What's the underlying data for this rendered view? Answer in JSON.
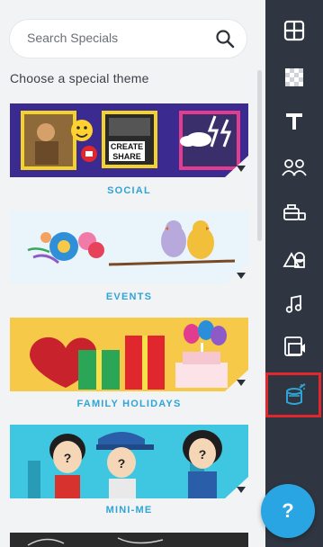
{
  "search": {
    "placeholder": "Search Specials",
    "icon": "search-icon"
  },
  "heading": "Choose a special theme",
  "cards": [
    {
      "label": "SOCIAL",
      "art": {
        "create_line1": "CREATE",
        "create_line2": "SHARE"
      }
    },
    {
      "label": "EVENTS"
    },
    {
      "label": "FAMILY HOLIDAYS"
    },
    {
      "label": "MINI-ME"
    }
  ],
  "sidebar": {
    "items": [
      {
        "name": "layout-icon"
      },
      {
        "name": "background-pattern-icon"
      },
      {
        "name": "text-icon"
      },
      {
        "name": "people-icon"
      },
      {
        "name": "objects-icon"
      },
      {
        "name": "shapes-icon"
      },
      {
        "name": "music-icon"
      },
      {
        "name": "video-icon"
      },
      {
        "name": "specials-icon",
        "selected": true
      }
    ],
    "help_label": "?"
  },
  "colors": {
    "sidebar_bg": "#2f3641",
    "accent": "#2fa4d6",
    "selected_outline": "#e0272e",
    "help_button": "#2aa5e4",
    "social_bg": "#3b2a8f",
    "events_bg": "#e9f4fb",
    "holidays_bg": "#f7c948",
    "minime_bg": "#3fc6e0"
  }
}
